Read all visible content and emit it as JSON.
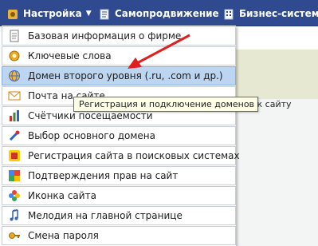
{
  "topbar": {
    "settings_label": "Настройка",
    "selfpromo_label": "Самопродвижение",
    "business_label": "Бизнес-система"
  },
  "menu": {
    "items": [
      {
        "label": "Базовая информация о фирме",
        "icon": "document-icon"
      },
      {
        "label": "Ключевые слова",
        "icon": "gear-icon"
      },
      {
        "label": "Домен второго уровня (.ru, .com и др.)",
        "icon": "globe-icon"
      },
      {
        "label": "Почта на сайте",
        "icon": "mail-icon"
      },
      {
        "label": "Счётчики посещаемости",
        "icon": "bar-chart-icon"
      },
      {
        "label": "Выбор основного домена",
        "icon": "wrench-icon"
      },
      {
        "label": "Регистрация сайта в поисковых системах",
        "icon": "search-engine-icon"
      },
      {
        "label": "Подтверждения прав на сайт",
        "icon": "google-icon"
      },
      {
        "label": "Иконка сайта",
        "icon": "flower-icon"
      },
      {
        "label": "Мелодия на главной странице",
        "icon": "music-note-icon"
      },
      {
        "label": "Смена пароля",
        "icon": "key-icon"
      }
    ],
    "highlighted_index": 2
  },
  "tooltip": {
    "text": "Регистрация и подключение доменов к сайту"
  },
  "colors": {
    "topbar": "#2f4a8e",
    "highlight": "#bcd5f0",
    "arrow": "#e02020",
    "tooltip_bg": "#ffffe8"
  }
}
